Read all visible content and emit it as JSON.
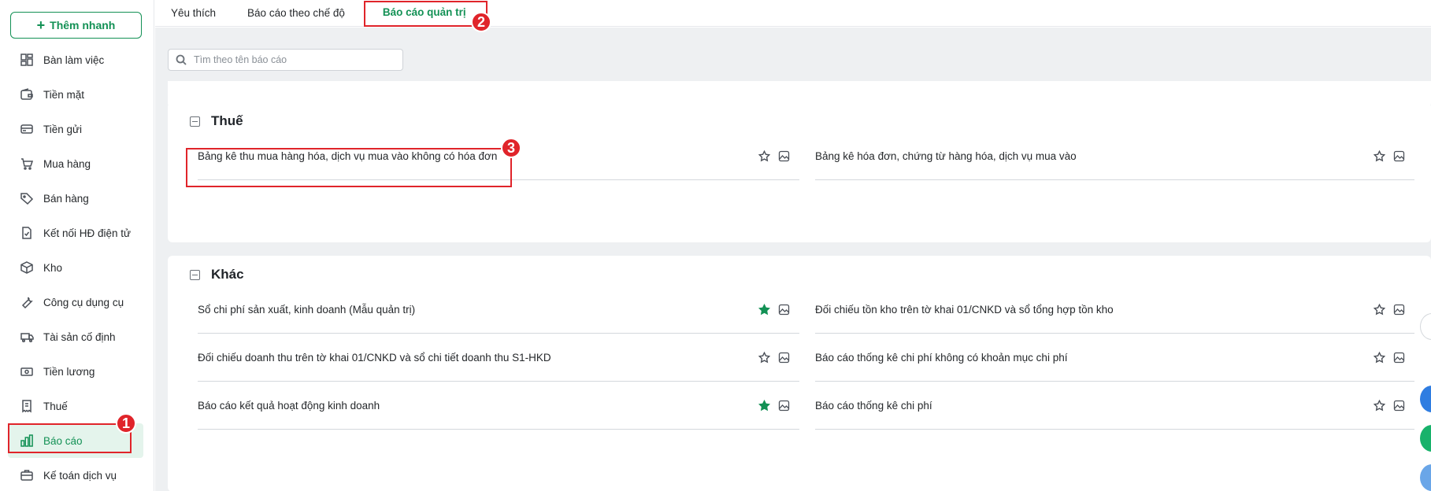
{
  "sidebar": {
    "quick_add_label": "Thêm nhanh",
    "items": [
      {
        "label": "Bàn làm việc",
        "icon": "dashboard-icon"
      },
      {
        "label": "Tiền mặt",
        "icon": "wallet-icon"
      },
      {
        "label": "Tiền gửi",
        "icon": "card-icon"
      },
      {
        "label": "Mua hàng",
        "icon": "cart-icon"
      },
      {
        "label": "Bán hàng",
        "icon": "tag-icon"
      },
      {
        "label": "Kết nối HĐ điện tử",
        "icon": "e-invoice-icon"
      },
      {
        "label": "Kho",
        "icon": "box-icon"
      },
      {
        "label": "Công cụ dụng cụ",
        "icon": "wrench-icon"
      },
      {
        "label": "Tài sản cố định",
        "icon": "truck-icon"
      },
      {
        "label": "Tiền lương",
        "icon": "money-icon"
      },
      {
        "label": "Thuế",
        "icon": "receipt-icon"
      },
      {
        "label": "Báo cáo",
        "icon": "bar-chart-icon",
        "active": true
      },
      {
        "label": "Kế toán dịch vụ",
        "icon": "briefcase-icon"
      }
    ]
  },
  "tabs": [
    {
      "label": "Yêu thích"
    },
    {
      "label": "Báo cáo theo chế độ"
    },
    {
      "label": "Báo cáo quản trị",
      "active": true
    }
  ],
  "search": {
    "placeholder": "Tìm theo tên báo cáo"
  },
  "sections": {
    "thue": {
      "title": "Thuế",
      "reports": [
        {
          "name": "Bảng kê thu mua hàng hóa, dịch vụ mua vào không có hóa đơn",
          "favorite": false
        },
        {
          "name": "Bảng kê hóa đơn, chứng từ hàng hóa, dịch vụ mua vào",
          "favorite": false
        }
      ]
    },
    "khac": {
      "title": "Khác",
      "reports": [
        {
          "name": "Sổ chi phí sản xuất, kinh doanh (Mẫu quản trị)",
          "favorite": true
        },
        {
          "name": "Đối chiếu tồn kho trên tờ khai 01/CNKD và sổ tổng hợp tồn kho",
          "favorite": false
        },
        {
          "name": "Đối chiếu doanh thu trên tờ khai 01/CNKD và sổ chi tiết doanh thu S1-HKD",
          "favorite": false
        },
        {
          "name": "Báo cáo thống kê chi phí không có khoản mục chi phí",
          "favorite": false
        },
        {
          "name": "Báo cáo kết quả hoạt động kinh doanh",
          "favorite": true
        },
        {
          "name": "Báo cáo thống kê chi phí",
          "favorite": false
        }
      ]
    }
  },
  "annotations": {
    "step1": "1",
    "step2": "2",
    "step3": "3"
  },
  "colors": {
    "accent": "#139155",
    "highlight": "#e0242a",
    "background": "#eef0f2"
  }
}
